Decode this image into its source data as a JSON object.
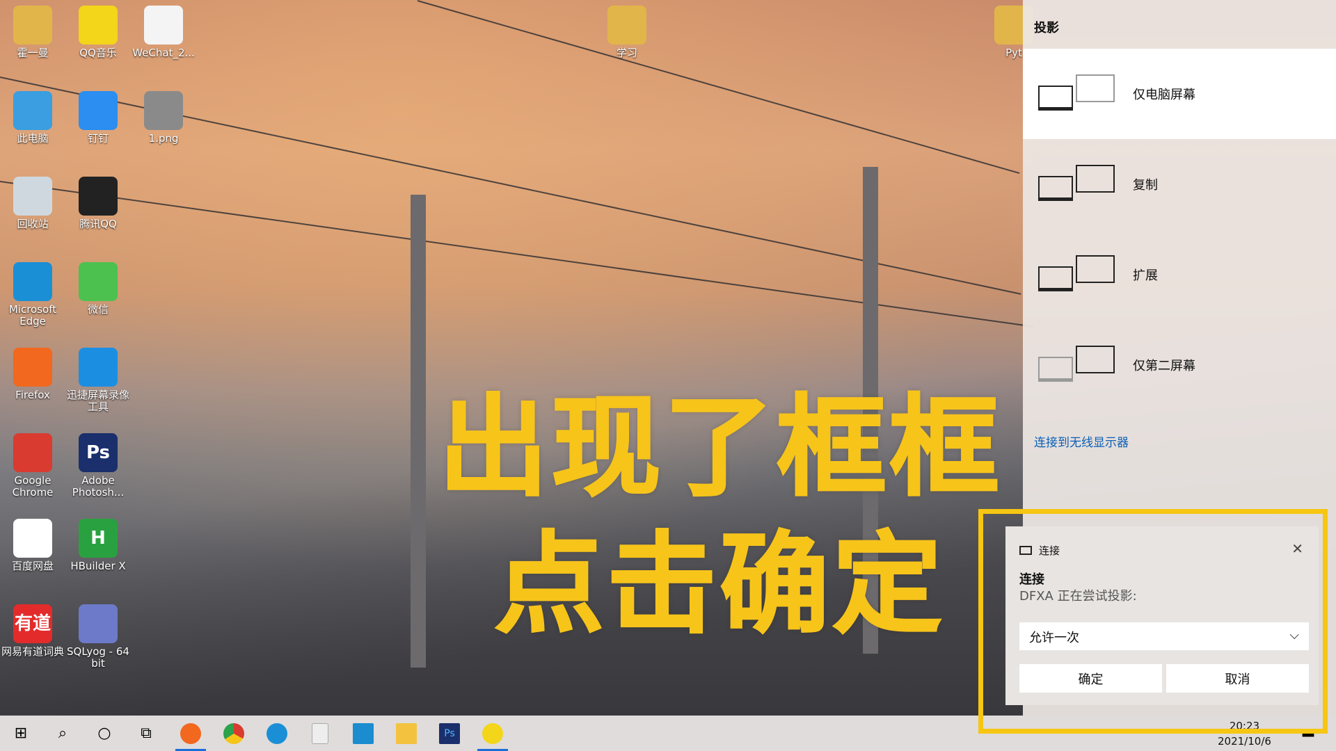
{
  "desktop": {
    "icons": [
      {
        "label": "霍一曼",
        "color": "#e2b54a"
      },
      {
        "label": "QQ音乐",
        "color": "#f3d51a"
      },
      {
        "label": "WeChat_2...",
        "color": "#f4f4f4"
      },
      {
        "label": "此电脑",
        "color": "#3a9ee0"
      },
      {
        "label": "钉钉",
        "color": "#2b8ef0"
      },
      {
        "label": "1.png",
        "color": "#8a8a8a"
      },
      {
        "label": "回收站",
        "color": "#cfd8de"
      },
      {
        "label": "腾讯QQ",
        "color": "#222"
      },
      {
        "label": "Microsoft Edge",
        "color": "#1b8fd6"
      },
      {
        "label": "微信",
        "color": "#4cc150"
      },
      {
        "label": "Firefox",
        "color": "#f1681e"
      },
      {
        "label": "迅捷屏幕录像工具",
        "color": "#1c8ee2"
      },
      {
        "label": "Google Chrome",
        "color": "#d93b30"
      },
      {
        "label": "Adobe Photosh...",
        "color": "#1a2f6b"
      },
      {
        "label": "百度网盘",
        "color": "#ffffff"
      },
      {
        "label": "HBuilder X",
        "color": "#2aa140"
      },
      {
        "label": "网易有道词典",
        "color": "#e32b2b"
      },
      {
        "label": "SQLyog - 64 bit",
        "color": "#6c7ac9"
      },
      {
        "label": "学习",
        "color": "#e2b54a"
      },
      {
        "label": "Pyt",
        "color": "#e2b54a"
      }
    ],
    "glyphs": {
      "ps": "Ps",
      "hb": "H",
      "yd": "有道"
    }
  },
  "overlay": {
    "line1": "出现了框框",
    "line2": "点击确定",
    "color": "#f7c41a"
  },
  "project_panel": {
    "title": "投影",
    "options": [
      {
        "label": "仅电脑屏幕",
        "selected": true
      },
      {
        "label": "复制",
        "selected": false
      },
      {
        "label": "扩展",
        "selected": false
      },
      {
        "label": "仅第二屏幕",
        "selected": false
      }
    ],
    "wireless_link": "连接到无线显示器"
  },
  "dialog": {
    "header": "连接",
    "title": "连接",
    "message": "DFXA 正在尝试投影:",
    "select_value": "允许一次",
    "ok": "确定",
    "cancel": "取消",
    "highlight_color": "#f6c612"
  },
  "taskbar": {
    "time": "20:23",
    "date": "2021/10/6",
    "accent": "#1a6ed8"
  }
}
